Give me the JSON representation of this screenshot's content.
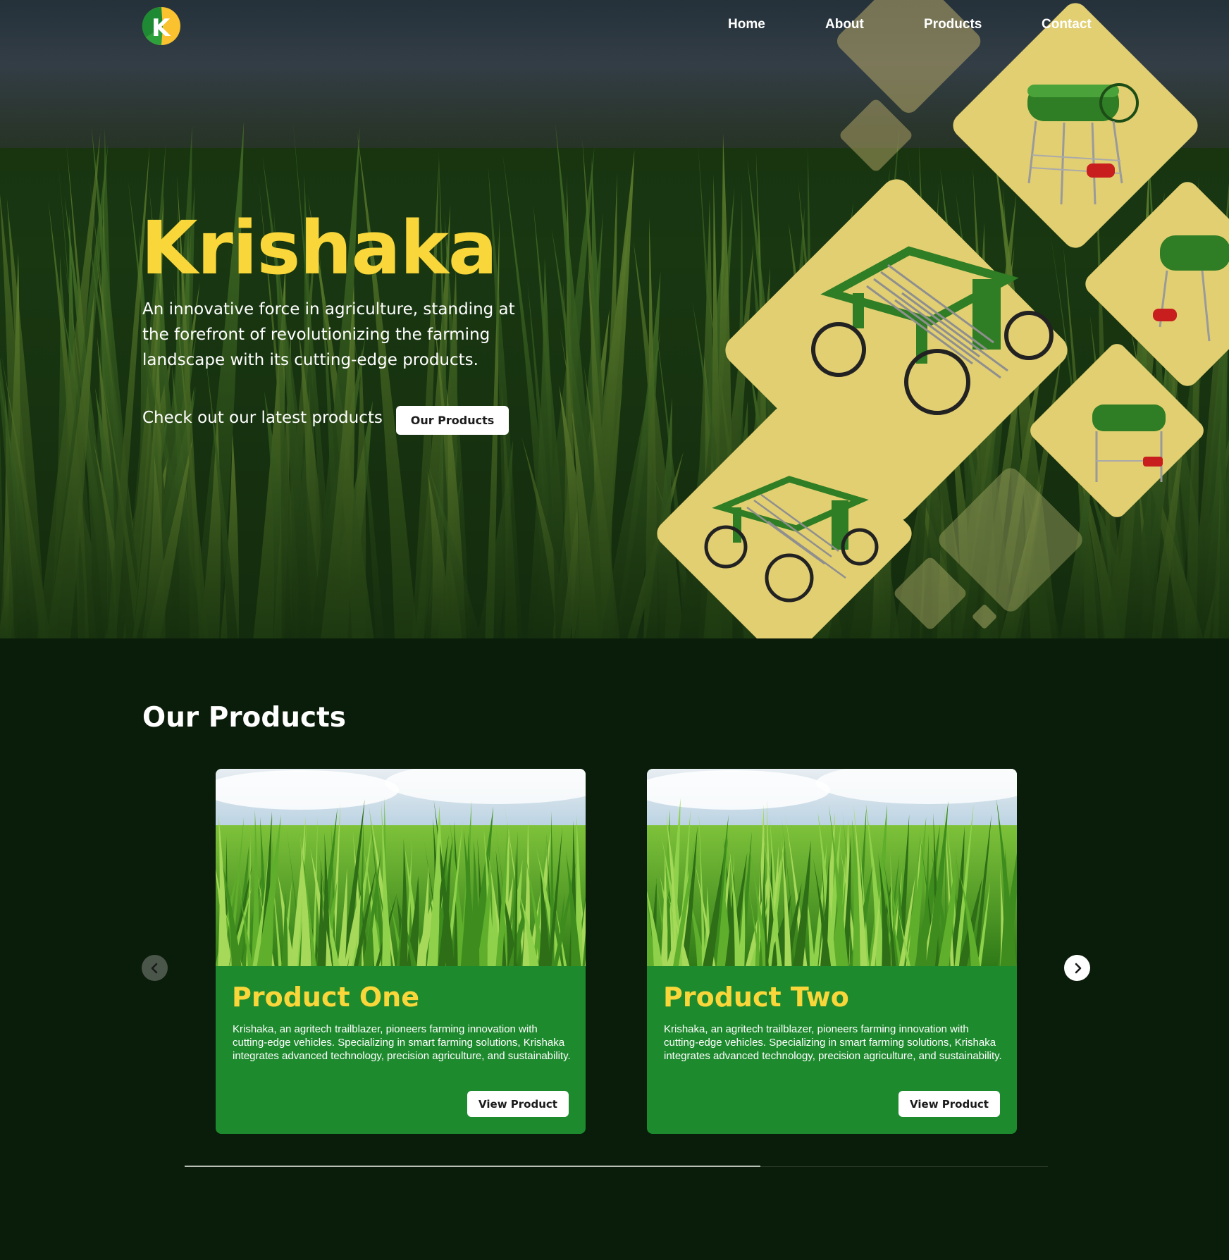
{
  "nav": {
    "logo_letter": "K",
    "items": [
      {
        "label": "Home"
      },
      {
        "label": "About"
      },
      {
        "label": "Products"
      },
      {
        "label": "Contact"
      }
    ]
  },
  "hero": {
    "title": "Krishaka",
    "description": "An innovative force in agriculture, standing at the forefront of revolutionizing the farming landscape with its cutting-edge products.",
    "cta_text": "Check out our latest products",
    "cta_button": "Our Products"
  },
  "products": {
    "heading": "Our Products",
    "items": [
      {
        "title": "Product One",
        "description": "Krishaka, an agritech trailblazer, pioneers farming innovation with cutting-edge vehicles. Specializing in smart farming solutions, Krishaka integrates advanced technology, precision agriculture, and sustainability.",
        "button": "View Product"
      },
      {
        "title": "Product Two",
        "description": "Krishaka, an agritech trailblazer, pioneers farming innovation with cutting-edge vehicles. Specializing in smart farming solutions, Krishaka integrates advanced technology, precision agriculture, and sustainability.",
        "button": "View Product"
      }
    ],
    "carousel_progress": 0.667
  },
  "icons": {
    "prev": "chevron-left-icon",
    "next": "chevron-right-icon"
  },
  "colors": {
    "accent_yellow": "#f9d63a",
    "card_green": "#1e8a2e",
    "page_bg": "#0a1c0a",
    "diamond_yellow": "#e2cf72"
  }
}
